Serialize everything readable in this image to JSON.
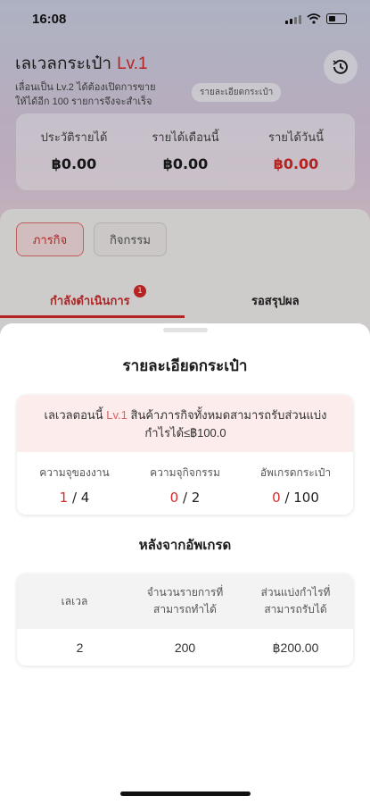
{
  "status_bar": {
    "time": "16:08"
  },
  "header": {
    "title": "เลเวลกระเป๋า",
    "level": "Lv.1",
    "upgrade_hint_line1": "เลื่อนเป็น Lv.2 ได้ต้องเปิดการขาย",
    "upgrade_hint_line2": "ให้ได้อีก 100 รายการจึงจะสำเร็จ",
    "detail_link": "รายละเอียดกระเป๋า",
    "history_icon": "history-clock-icon"
  },
  "income": [
    {
      "label": "ประวัติรายได้",
      "value": "฿0.00"
    },
    {
      "label": "รายได้เดือนนี้",
      "value": "฿0.00"
    },
    {
      "label": "รายได้วันนี้",
      "value": "฿0.00"
    }
  ],
  "tabs": {
    "active": "ภารกิจ",
    "inactive": "กิจกรรม"
  },
  "sub_tabs": {
    "active": "กำลังดำเนินการ",
    "badge": "1",
    "inactive": "รอสรุปผล"
  },
  "sheet": {
    "title": "รายละเอียดกระเป๋า",
    "current_level_prefix": "เลเวลตอนนี้",
    "current_level": "Lv.1",
    "current_level_desc": "สินค้าภารกิจทั้งหมดสามารถรับส่วนแบ่ง",
    "current_level_desc2": "กำไรได้≤฿100.0",
    "stats": [
      {
        "label": "ความจุของงาน",
        "current": "1",
        "total": "/ 4"
      },
      {
        "label": "ความจุกิจกรรม",
        "current": "0",
        "total": "/ 2"
      },
      {
        "label": "อัพเกรดกระเป๋า",
        "current": "0",
        "total": "/ 100"
      }
    ],
    "after_upgrade_title": "หลังจากอัพเกรด",
    "table": {
      "headers": [
        {
          "line1": "เลเวล",
          "line2": ""
        },
        {
          "line1": "จำนวนรายการที่",
          "line2": "สามารถทำได้"
        },
        {
          "line1": "ส่วนแบ่งกำไรที่",
          "line2": "สามารถรับได้"
        }
      ],
      "row": [
        "2",
        "200",
        "฿200.00"
      ]
    }
  },
  "colors": {
    "accent_red": "#d52a2a",
    "level_tint": "#fcecec"
  }
}
